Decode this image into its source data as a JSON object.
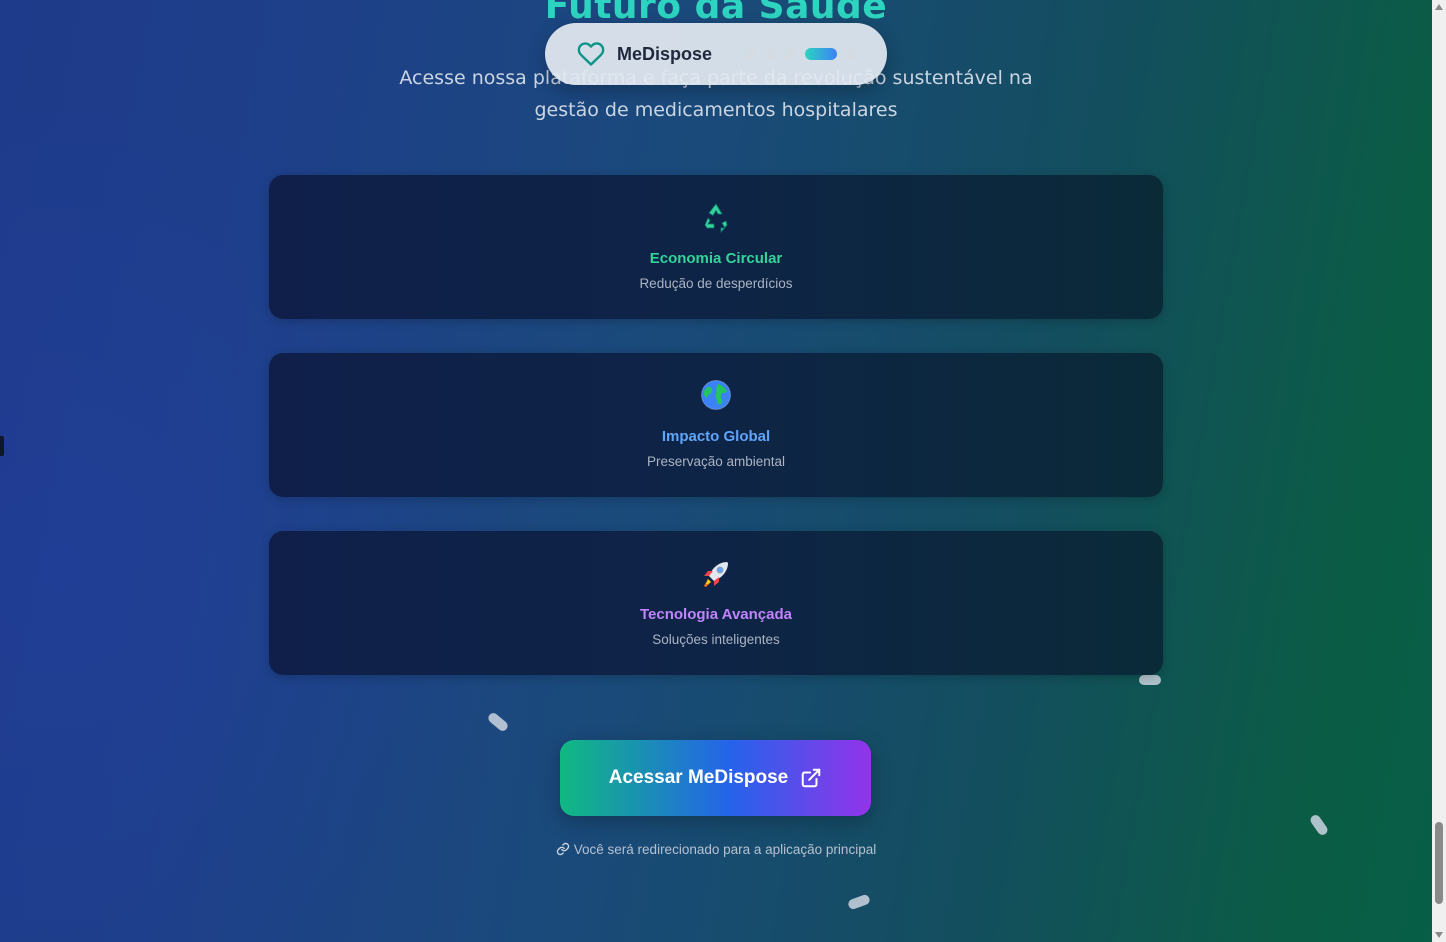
{
  "hero": {
    "title": "Futuro da Saúde",
    "subtitle": "Acesse nossa plataforma e faça parte da revolução sustentável na gestão de medicamentos hospitalares"
  },
  "nav": {
    "brand": "MeDispose",
    "icon": "heart-icon",
    "slides_total": 5,
    "active_slide": 4
  },
  "features": [
    {
      "icon": "recycle-icon",
      "title": "Economia Circular",
      "description": "Redução de desperdícios",
      "color": "#34d399"
    },
    {
      "icon": "globe-icon",
      "title": "Impacto Global",
      "description": "Preservação ambiental",
      "color": "#60a5fa"
    },
    {
      "icon": "rocket-icon",
      "title": "Tecnologia Avançada",
      "description": "Soluções inteligentes",
      "color": "#c084fc"
    }
  ],
  "cta": {
    "label": "Acessar MeDispose",
    "icon": "external-link-icon"
  },
  "note": {
    "icon": "link-icon",
    "text": "Você será redirecionado para a aplicação principal"
  },
  "colors": {
    "accent_teal": "#2dd4bf",
    "cta_start": "#10b981",
    "cta_mid": "#2563eb",
    "cta_end": "#9333ea"
  }
}
